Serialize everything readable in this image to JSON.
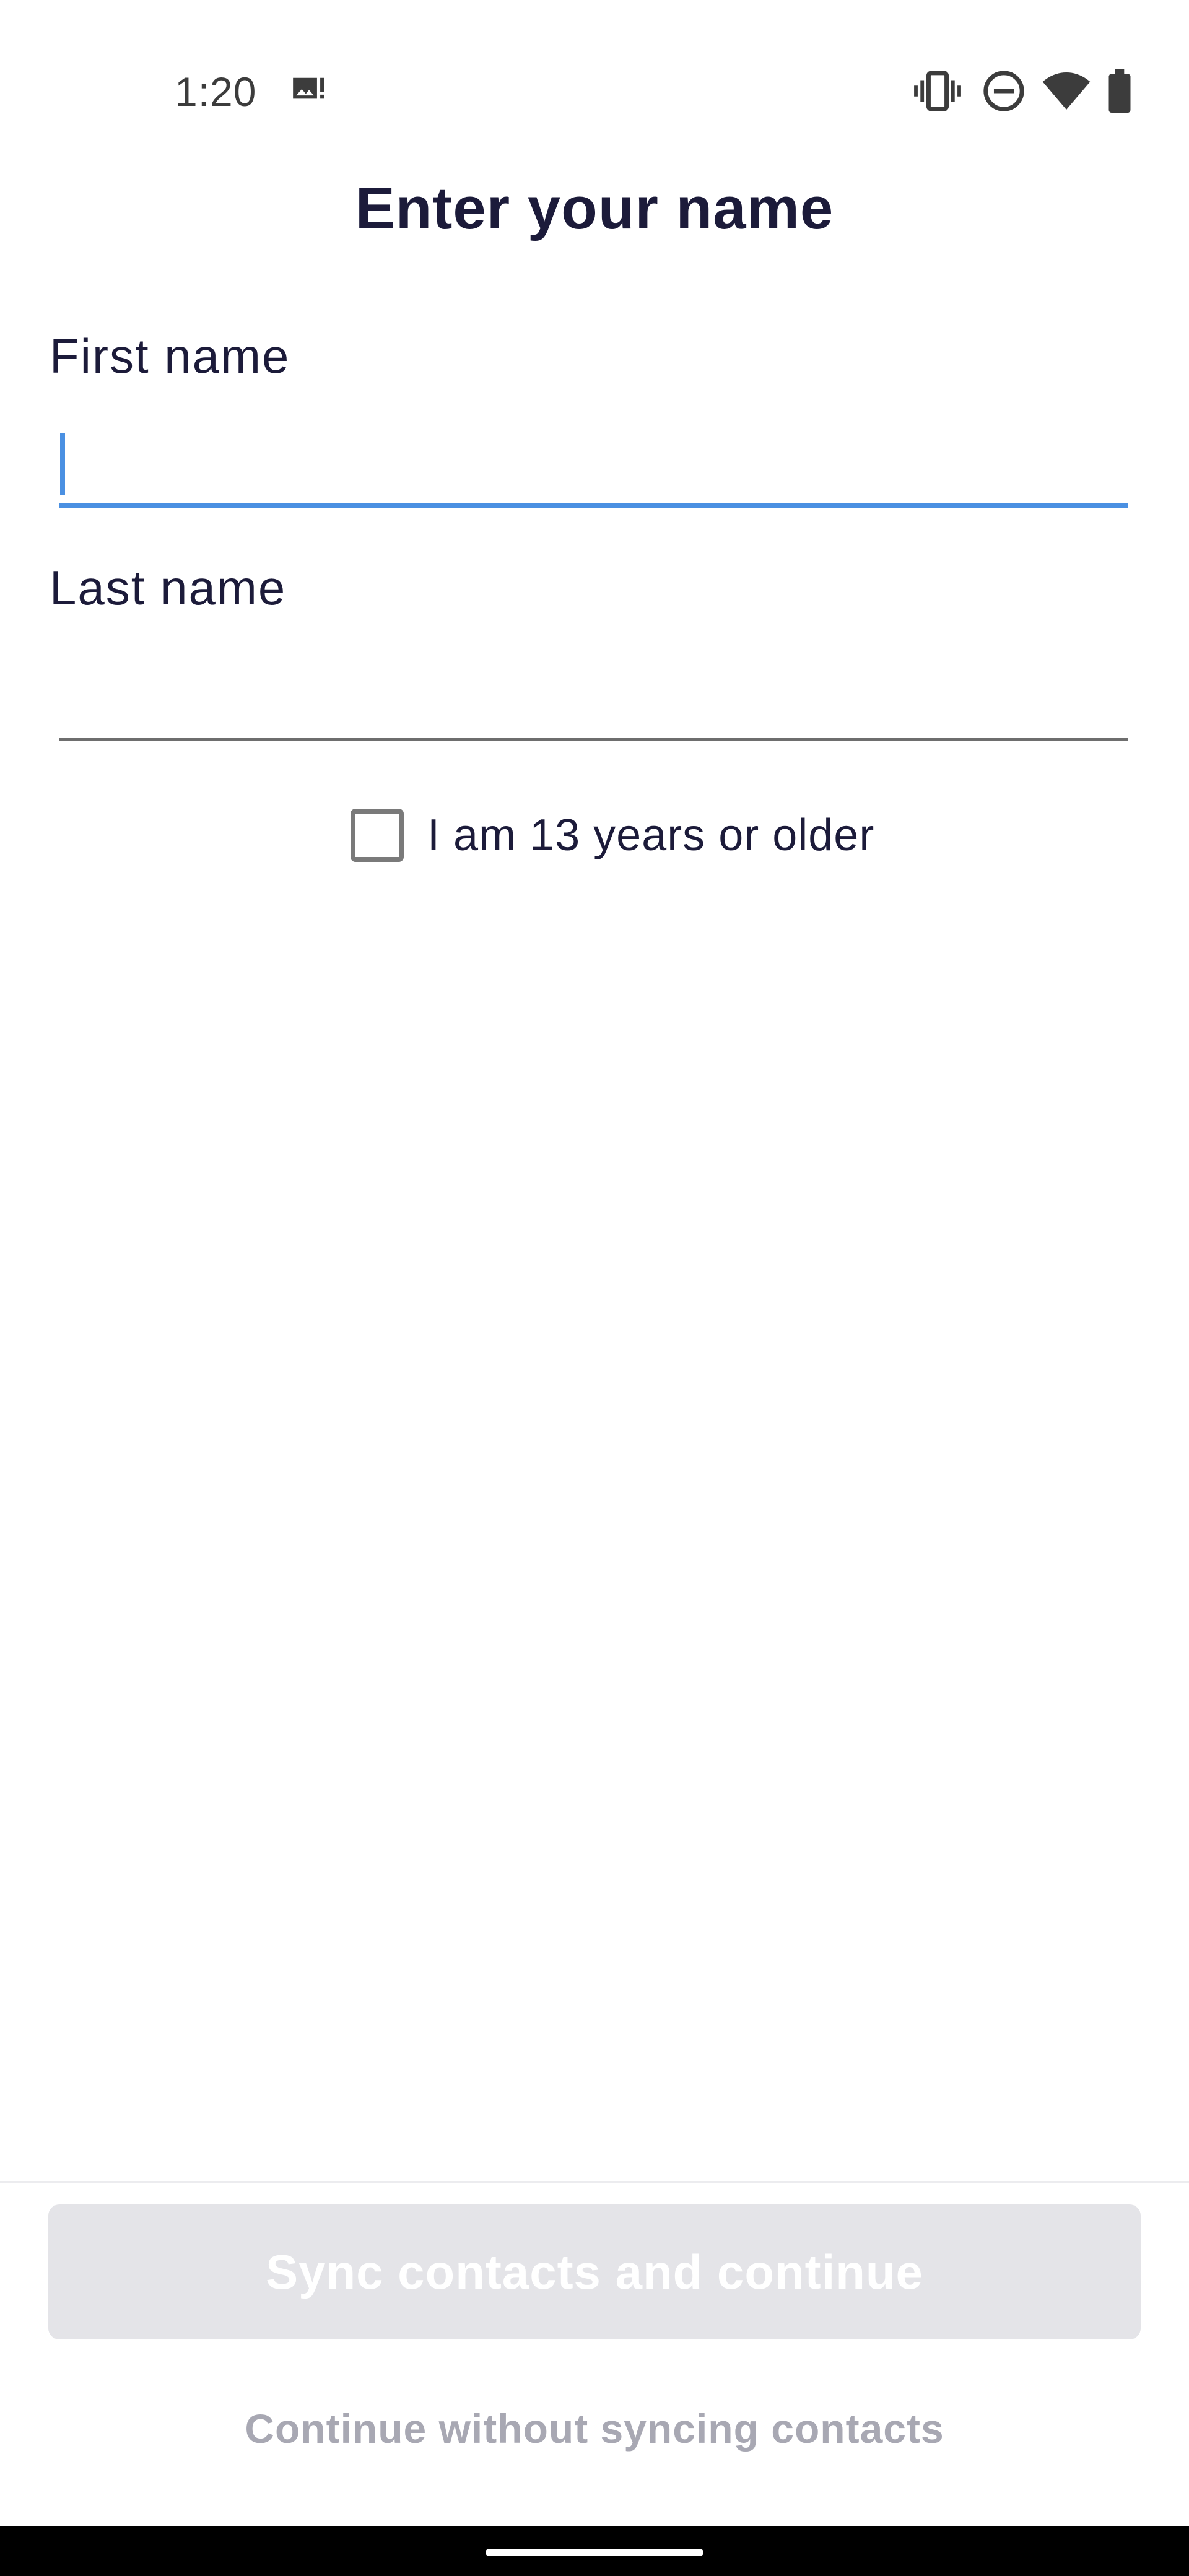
{
  "status_bar": {
    "time": "1:20",
    "left_icons": [
      "photo-alert-icon"
    ],
    "right_icons": [
      "vibrate-icon",
      "do-not-disturb-icon",
      "wifi-icon",
      "battery-icon"
    ]
  },
  "page": {
    "title": "Enter your name"
  },
  "form": {
    "first_name": {
      "label": "First name",
      "value": "",
      "placeholder": ""
    },
    "last_name": {
      "label": "Last name",
      "value": "",
      "placeholder": ""
    },
    "age_checkbox": {
      "label": "I am 13 years or older",
      "checked": false
    }
  },
  "footer": {
    "primary_button_label": "Sync contacts and continue",
    "secondary_link_label": "Continue without syncing contacts"
  },
  "colors": {
    "accent": "#4a90e2",
    "title_text": "#1c1b3a",
    "disabled_button_bg": "#e4e4e8",
    "disabled_link_text": "#a8a8b3"
  }
}
